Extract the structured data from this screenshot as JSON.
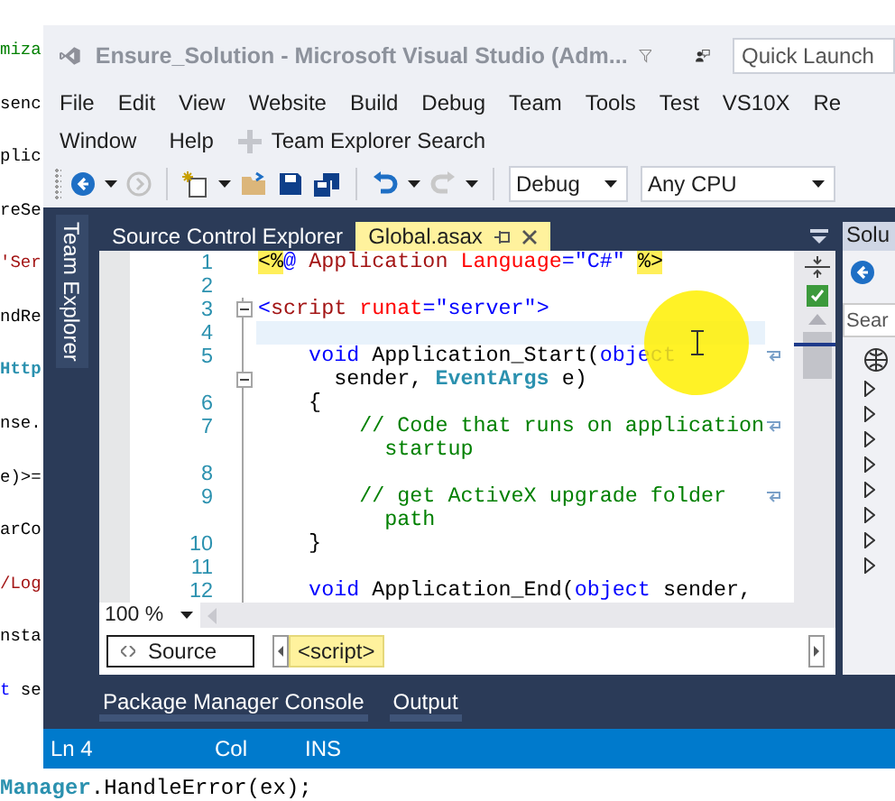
{
  "background": {
    "left_lines": [
      {
        "segments": [
          {
            "text": "miza",
            "kind": "comment"
          }
        ]
      },
      {
        "segments": [
          {
            "text": "senc",
            "kind": "plain"
          }
        ]
      },
      {
        "segments": [
          {
            "text": "plic",
            "kind": "plain"
          }
        ]
      },
      {
        "segments": [
          {
            "text": "reSe",
            "kind": "plain"
          }
        ]
      },
      {
        "segments": [
          {
            "text": "'Ser",
            "kind": "string"
          }
        ]
      },
      {
        "segments": [
          {
            "text": "ndRe",
            "kind": "plain"
          }
        ]
      },
      {
        "segments": [
          {
            "text": "Http",
            "kind": "type"
          }
        ]
      },
      {
        "segments": [
          {
            "text": "nse.",
            "kind": "plain"
          }
        ]
      },
      {
        "segments": [
          {
            "text": "e)>=",
            "kind": "plain"
          }
        ]
      },
      {
        "segments": [
          {
            "text": "arCo",
            "kind": "plain"
          }
        ]
      },
      {
        "segments": [
          {
            "text": "/Log",
            "kind": "string"
          }
        ]
      },
      {
        "segments": [
          {
            "text": "nsta",
            "kind": "plain"
          }
        ]
      },
      {
        "segments": [
          {
            "text": "t",
            "kind": "keyword"
          },
          {
            "text": " se",
            "kind": "plain"
          }
        ]
      }
    ],
    "bottom_lines": [
      {
        "segments": [
          {
            "text": "Manager",
            "kind": "type"
          },
          {
            "text": ".HandleError(ex);",
            "kind": "plain"
          }
        ]
      }
    ]
  },
  "window": {
    "title": "Ensure_Solution - Microsoft Visual Studio (Adm...",
    "quick_launch": {
      "placeholder": "Quick Launch"
    }
  },
  "menu": {
    "row_1": [
      "File",
      "Edit",
      "View",
      "Website",
      "Build",
      "Debug",
      "Team",
      "Tools",
      "Test",
      "VS10X",
      "Re"
    ],
    "row_2": [
      "Window",
      "Help"
    ],
    "search_label": "Team Explorer Search"
  },
  "toolbar": {
    "configuration": "Debug",
    "platform": "Any CPU"
  },
  "side_tab": "Team Explorer",
  "document_tabs": [
    {
      "label": "Source Control Explorer",
      "selected": false
    },
    {
      "label": "Global.asax",
      "selected": true
    }
  ],
  "editor": {
    "lines": [
      {
        "number": "1",
        "fold": false,
        "current": false,
        "segments": [
          {
            "text": "<%",
            "kind": "delim"
          },
          {
            "text": "@ ",
            "kind": "tag"
          },
          {
            "text": "Application",
            "kind": "element"
          },
          {
            "text": " Language",
            "kind": "attr"
          },
          {
            "text": "=\"C#\" ",
            "kind": "tag"
          },
          {
            "text": "%>",
            "kind": "delim"
          }
        ]
      },
      {
        "number": "2",
        "fold": false,
        "current": false
      },
      {
        "number": "3",
        "fold": true,
        "current": false,
        "segments": [
          {
            "text": "<",
            "kind": "tag"
          },
          {
            "text": "script",
            "kind": "element"
          },
          {
            "text": " runat",
            "kind": "attr"
          },
          {
            "text": "=\"server\">",
            "kind": "tag"
          }
        ]
      },
      {
        "number": "4",
        "fold": false,
        "current": true
      },
      {
        "number": "5",
        "fold": true,
        "current": false,
        "segments": [
          {
            "text": "    void",
            "kind": "keyword"
          },
          {
            "text": " Application_Start(",
            "kind": "plain"
          },
          {
            "text": "object",
            "kind": "keyword"
          }
        ],
        "wrapped_segments": [
          {
            "text": "      sender, ",
            "kind": "plain"
          },
          {
            "text": "EventArgs",
            "kind": "type"
          },
          {
            "text": " e)",
            "kind": "plain"
          }
        ]
      },
      {
        "number": "6",
        "fold": false,
        "current": false,
        "segments": [
          {
            "text": "    {",
            "kind": "plain"
          }
        ]
      },
      {
        "number": "7",
        "fold": false,
        "current": false,
        "segments": [
          {
            "text": "        // Code that runs on application",
            "kind": "comment"
          }
        ],
        "wrapped_segments": [
          {
            "text": "          startup",
            "kind": "comment"
          }
        ]
      },
      {
        "number": "8",
        "fold": false,
        "current": false
      },
      {
        "number": "9",
        "fold": false,
        "current": false,
        "segments": [
          {
            "text": "        // get ActiveX upgrade folder",
            "kind": "comment"
          }
        ],
        "wrapped_segments": [
          {
            "text": "          path",
            "kind": "comment"
          }
        ]
      },
      {
        "number": "10",
        "fold": false,
        "current": false,
        "segments": [
          {
            "text": "    }",
            "kind": "plain"
          }
        ]
      },
      {
        "number": "11",
        "fold": false,
        "current": false
      },
      {
        "number": "12",
        "fold": false,
        "current": false,
        "segments": [
          {
            "text": "    void",
            "kind": "keyword"
          },
          {
            "text": " Application_End(",
            "kind": "plain"
          },
          {
            "text": "object",
            "kind": "keyword"
          },
          {
            "text": " sender,",
            "kind": "plain"
          }
        ]
      }
    ],
    "zoom": "100 %",
    "view_button": "Source",
    "breadcrumb": "<script>"
  },
  "solution_panel": {
    "title": "Solu",
    "search": {
      "placeholder": "Sear"
    }
  },
  "bottom_tabs": [
    "Package Manager Console",
    "Output"
  ],
  "status_bar": {
    "line": "Ln 4",
    "column": "Col",
    "mode": "INS"
  }
}
